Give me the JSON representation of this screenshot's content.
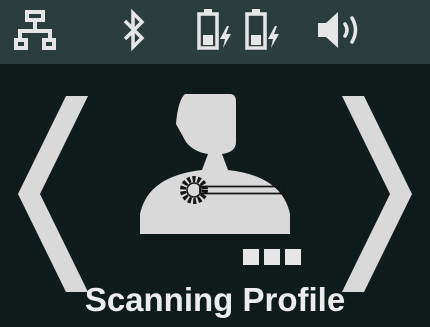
{
  "status_bar": {
    "icons": [
      "network-icon",
      "bluetooth-icon",
      "battery-charging-icon",
      "battery-charging-icon",
      "speaker-volume-icon"
    ]
  },
  "main": {
    "title": "Scanning Profile",
    "icon": "person-scanner-icon",
    "prev_icon": "chevron-left-icon",
    "next_icon": "chevron-right-icon",
    "more_icon": "more-dots-icon"
  },
  "colors": {
    "background": "#101c1c",
    "status_bar": "#2c3d3e",
    "foreground": "#e6e6e6"
  }
}
